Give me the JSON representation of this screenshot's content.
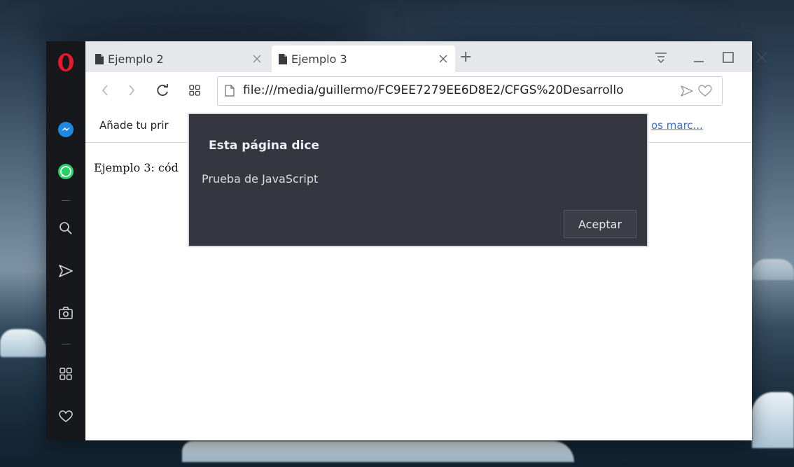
{
  "tabs": [
    {
      "title": "Ejemplo 2",
      "active": false
    },
    {
      "title": "Ejemplo 3",
      "active": true
    }
  ],
  "new_tab_symbol": "+",
  "address_bar": {
    "url": "file:///media/guillermo/FC9EE7279EE6D8E2/CFGS%20Desarrollo"
  },
  "bookmarks_bar": {
    "hint": "Añade tu prir",
    "other_link": "os marc..."
  },
  "page": {
    "text": "Ejemplo 3: cód"
  },
  "dialog": {
    "title": "Esta página dice",
    "message": "Prueba de JavaScript",
    "ok_label": "Aceptar"
  },
  "sidebar": {
    "icons": [
      "opera-logo-icon",
      "messenger-icon",
      "whatsapp-icon",
      "search-icon",
      "send-icon",
      "camera-icon",
      "apps-grid-icon",
      "heart-icon"
    ]
  },
  "colors": {
    "opera_red": "#e8192c",
    "messenger_blue": "#1e88e5",
    "whatsapp_green": "#25d366",
    "dialog_bg": "#35363f"
  }
}
